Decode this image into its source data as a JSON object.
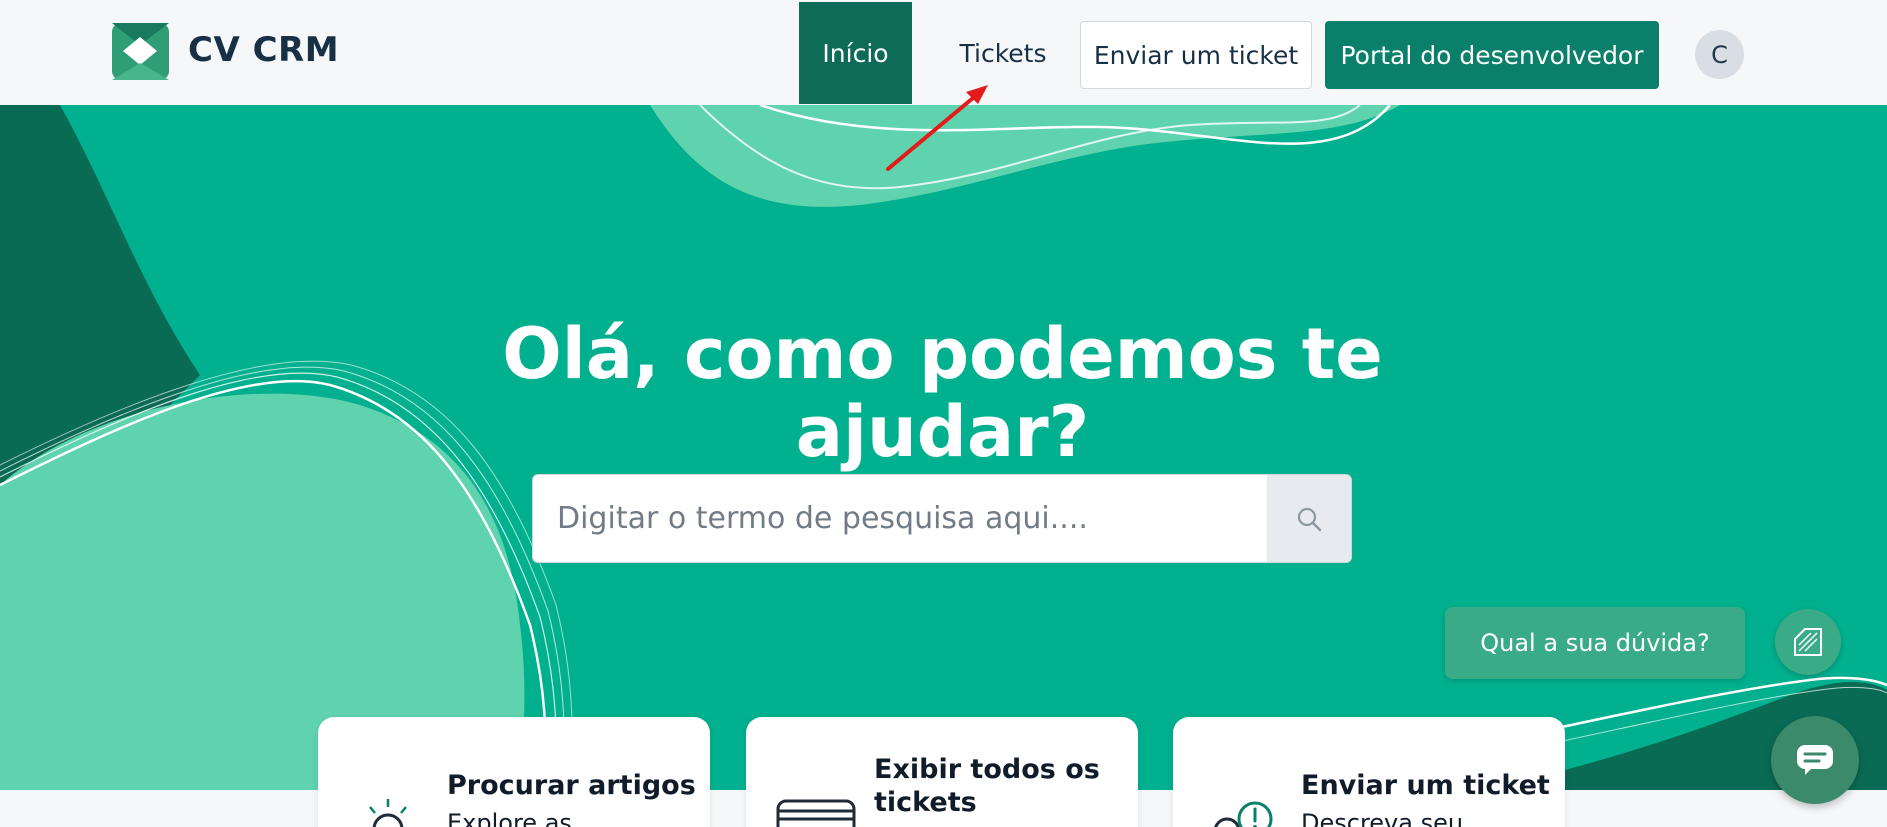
{
  "header": {
    "brand": "CV CRM",
    "nav": {
      "inicio": "Início",
      "tickets": "Tickets",
      "enviar_ticket": "Enviar um ticket",
      "portal": "Portal do desenvolvedor"
    },
    "avatar_initial": "C"
  },
  "hero": {
    "title": "Olá, como podemos te ajudar?",
    "search": {
      "placeholder": "Digitar o termo de pesquisa aqui....",
      "button_icon": "search-icon"
    }
  },
  "help_widget": {
    "bubble_label": "Qual a sua dúvida?",
    "icon": "knowledge-icon",
    "chat_icon": "chat-icon"
  },
  "cards": [
    {
      "title": "Procurar artigos",
      "desc": "Explore as",
      "icon": "lightbulb-icon"
    },
    {
      "title": "Exibir todos os tickets",
      "desc": "",
      "icon": "tickets-stack-icon"
    },
    {
      "title": "Enviar um ticket",
      "desc": "Descreva seu",
      "icon": "alert-person-icon"
    }
  ],
  "colors": {
    "brand_dark": "#0d6b58",
    "brand": "#0a7f69",
    "hero_bg": "#00b08e",
    "hero_light": "#5fd3ae",
    "text_dark": "#173046",
    "annotation": "#e31b1b"
  }
}
